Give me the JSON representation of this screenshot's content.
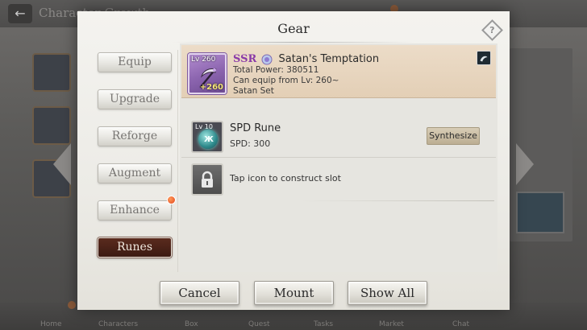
{
  "background": {
    "title": "Character Growth",
    "nav": [
      "Home",
      "Characters",
      "Box",
      "Quest",
      "Tasks",
      "Market",
      "Chat"
    ]
  },
  "dialog": {
    "title": "Gear",
    "help_icon": "question-diamond-icon"
  },
  "tabs": [
    {
      "label": "Equip",
      "active": false,
      "badge": false
    },
    {
      "label": "Upgrade",
      "active": false,
      "badge": false
    },
    {
      "label": "Reforge",
      "active": false,
      "badge": false
    },
    {
      "label": "Augment",
      "active": false,
      "badge": false
    },
    {
      "label": "Enhance",
      "active": false,
      "badge": true
    },
    {
      "label": "Runes",
      "active": true,
      "badge": false
    }
  ],
  "item": {
    "level": "Lv 260",
    "plus": "+260",
    "rarity": "SSR",
    "name": "Satan's Temptation",
    "total_power": "Total Power: 380511",
    "equip_level": "Can equip from Lv: 260~",
    "set": "Satan Set",
    "icon": "scythe-icon"
  },
  "rune": {
    "level": "Lv 10",
    "name": "SPD Rune",
    "stat": "SPD: 300",
    "synthesize_label": "Synthesize"
  },
  "locked_slot": {
    "text": "Tap icon to construct slot"
  },
  "buttons": {
    "cancel": "Cancel",
    "mount": "Mount",
    "show_all": "Show All"
  },
  "colors": {
    "rarity": "#8a3aa8",
    "active_tab": "#4a2218",
    "header_bg": "#e6d3bb",
    "badge": "#e2471c"
  }
}
